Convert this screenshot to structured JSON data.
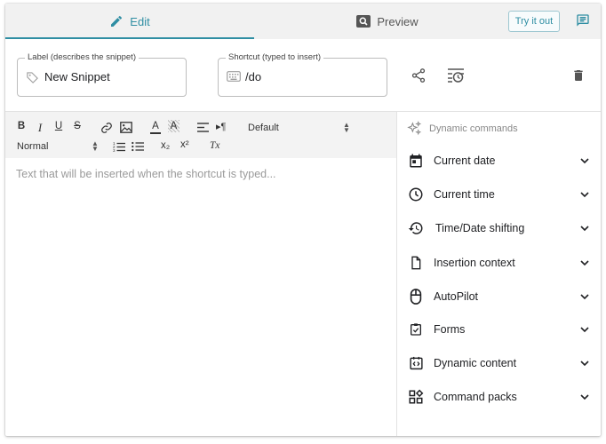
{
  "tabs": {
    "edit": "Edit",
    "preview": "Preview"
  },
  "header": {
    "try_it_out": "Try it out"
  },
  "label_field": {
    "legend": "Label (describes the snippet)",
    "value": "New Snippet"
  },
  "shortcut_field": {
    "legend": "Shortcut (typed to insert)",
    "value": "/do"
  },
  "toolbar": {
    "bold": "B",
    "italic": "I",
    "underline": "U",
    "strike": "S",
    "text_color": "A",
    "background_color": "A",
    "font_select": "Default",
    "size_select": "Normal",
    "subscript": "x₂",
    "superscript": "x²",
    "clear_format": "Tx"
  },
  "editor": {
    "placeholder": "Text that will be inserted when the shortcut is typed..."
  },
  "panel": {
    "title": "Dynamic commands",
    "items": [
      {
        "label": "Current date",
        "icon": "calendar-icon"
      },
      {
        "label": "Current time",
        "icon": "clock-icon"
      },
      {
        "label": "Time/Date shifting",
        "icon": "history-icon"
      },
      {
        "label": "Insertion context",
        "icon": "document-icon"
      },
      {
        "label": "AutoPilot",
        "icon": "mouse-icon"
      },
      {
        "label": "Forms",
        "icon": "clipboard-check-icon"
      },
      {
        "label": "Dynamic content",
        "icon": "code-calendar-icon"
      },
      {
        "label": "Command packs",
        "icon": "widgets-icon"
      }
    ]
  },
  "colors": {
    "accent": "#2f8ea3",
    "icon": "#555555"
  }
}
